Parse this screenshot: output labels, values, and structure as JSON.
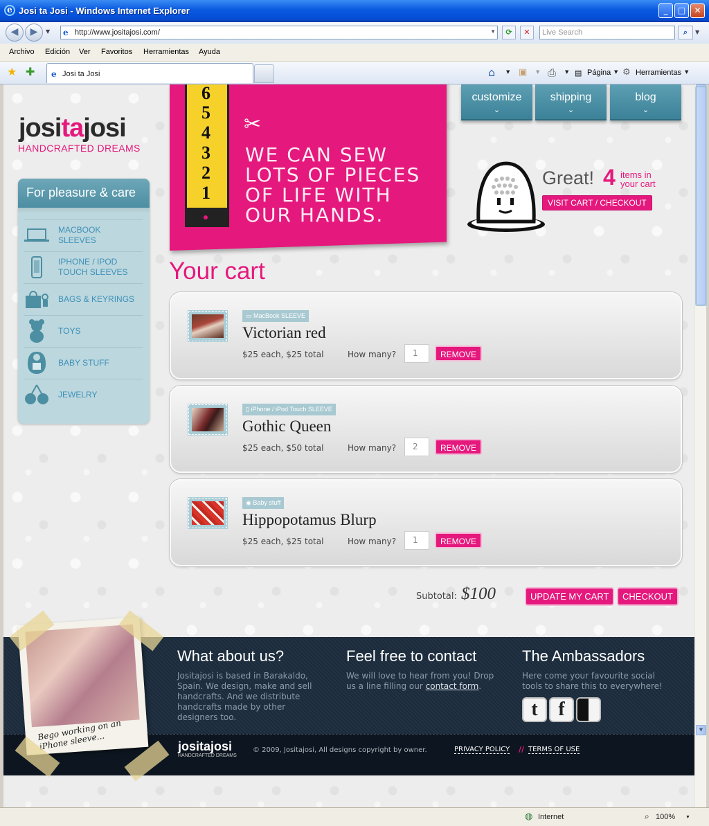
{
  "window": {
    "title": "Josi ta Josi - Windows Internet Explorer"
  },
  "browser": {
    "url": "http://www.jositajosi.com/",
    "search_placeholder": "Live Search",
    "menu": [
      "Archivo",
      "Edición",
      "Ver",
      "Favoritos",
      "Herramientas",
      "Ayuda"
    ],
    "tab_title": "Josi ta Josi",
    "page_label": "Página",
    "tools_label": "Herramientas",
    "status_zone": "Internet",
    "zoom": "100%"
  },
  "site": {
    "logo_left": "josi",
    "logo_mid": "ta",
    "logo_right": "josi",
    "logo_sub": "HANDCRAFTED DREAMS",
    "accent": "#e5187d",
    "teal": "#4c8ea2"
  },
  "banner": {
    "tape_numbers": [
      "6",
      "5",
      "4",
      "3",
      "2",
      "1"
    ],
    "slogan": "WE CAN SEW LOTS OF PIECES OF LIFE WITH OUR HANDS."
  },
  "topnav": [
    {
      "label": "customize"
    },
    {
      "label": "shipping"
    },
    {
      "label": "blog"
    }
  ],
  "cart_summary": {
    "great": "Great!",
    "count": "4",
    "count_label_1": "items in",
    "count_label_2": "your cart",
    "visit_label": "VISIT CART / CHECKOUT"
  },
  "sidebar": {
    "title": "For pleasure & care",
    "items": [
      {
        "label_1": "MACBOOK",
        "label_2": "SLEEVES",
        "icon": "laptop-icon"
      },
      {
        "label_1": "IPHONE / IPOD",
        "label_2": "TOUCH SLEEVES",
        "icon": "phone-icon"
      },
      {
        "label_1": "BAGS & KEYRINGS",
        "label_2": "",
        "icon": "bag-icon"
      },
      {
        "label_1": "TOYS",
        "label_2": "",
        "icon": "teddy-bear-icon"
      },
      {
        "label_1": "BABY STUFF",
        "label_2": "",
        "icon": "bib-icon"
      },
      {
        "label_1": "JEWELRY",
        "label_2": "",
        "icon": "cherries-icon"
      }
    ]
  },
  "cart": {
    "title": "Your cart",
    "how_many_label": "How many?",
    "remove_label": "REMOVE",
    "items": [
      {
        "tag": "MacBook SLEEVE",
        "name": "Victorian red",
        "price": "$25 each, $25 total",
        "qty": "1"
      },
      {
        "tag": "iPhone / iPod Touch SLEEVE",
        "name": "Gothic Queen",
        "price": "$25 each, $50 total",
        "qty": "2"
      },
      {
        "tag": "Baby stuff",
        "name": "Hippopotamus Blurp",
        "price": "$25 each, $25 total",
        "qty": "1"
      }
    ],
    "subtotal_label": "Subtotal:",
    "subtotal": "$100",
    "update_label": "UPDATE MY CART",
    "checkout_label": "CHECKOUT"
  },
  "footer": {
    "polaroid_caption_1": "Bego working on an",
    "polaroid_caption_2": "iPhone sleeve...",
    "about_title": "What about us?",
    "about_text": "Jositajosi is based in Barakaldo, Spain. We design, make and sell handcrafts. And we distribute handcrafts made by other designers too.",
    "contact_title": "Feel free to contact",
    "contact_text": "We will love to hear from you! Drop us a line filling our",
    "contact_link": "contact form",
    "contact_end": ".",
    "amb_title": "The Ambassadors",
    "amb_text": "Here come your favourite social tools to share this to everywhere!",
    "logo": "jositajosi",
    "logo_sub": "HANDCRAFTED DREAMS",
    "copyright": "© 2009, Jositajosi, All designs copyright by owner.",
    "privacy": "PRIVACY POLICY",
    "separator": "//",
    "terms": "TERMS OF USE"
  }
}
